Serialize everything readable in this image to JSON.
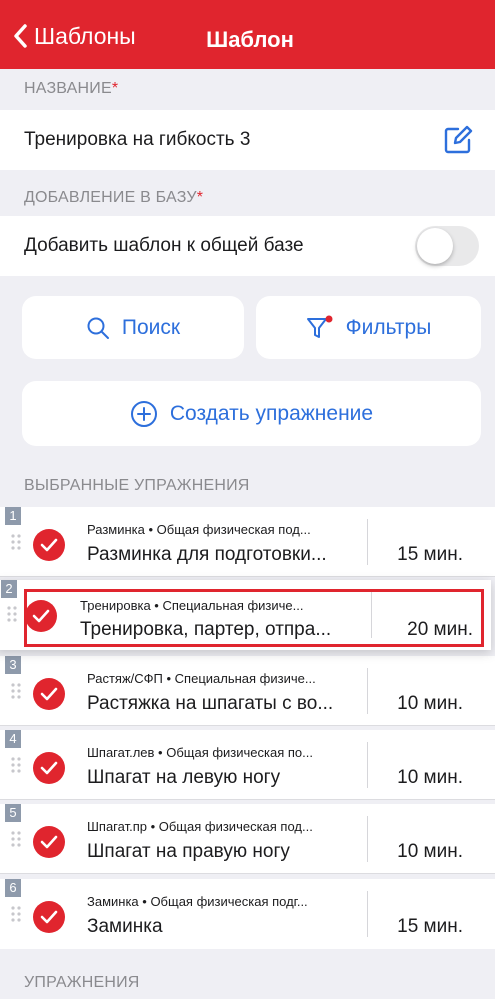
{
  "navbar": {
    "back_label": "Шаблоны",
    "title": "Шаблон"
  },
  "name_section": {
    "header": "НАЗВАНИЕ",
    "required_mark": "*",
    "value": "Тренировка на гибкость 3",
    "edit_icon": "edit-pencil-icon"
  },
  "base_section": {
    "header": "ДОБАВЛЕНИЕ В БАЗУ",
    "required_mark": "*",
    "toggle_label": "Добавить шаблон к общей базе",
    "toggle_on": false
  },
  "actions": {
    "search_label": "Поиск",
    "filters_label": "Фильтры",
    "create_label": "Создать упражнение"
  },
  "selected_section": {
    "header": "ВЫБРАННЫЕ УПРАЖНЕНИЯ",
    "items": [
      {
        "num": "1",
        "category": "Разминка • Общая физическая под...",
        "name": "Разминка для подготовки...",
        "duration": "15 мин."
      },
      {
        "num": "2",
        "category": "Тренировка • Специальная физиче...",
        "name": "Тренировка, партер, отпра...",
        "duration": "20 мин."
      },
      {
        "num": "3",
        "category": "Растяж/СФП • Специальная физиче...",
        "name": "Растяжка на шпагаты с во...",
        "duration": "10 мин."
      },
      {
        "num": "4",
        "category": "Шпагат.лев • Общая физическая по...",
        "name": "Шпагат на левую ногу",
        "duration": "10 мин."
      },
      {
        "num": "5",
        "category": "Шпагат.пр • Общая физическая под...",
        "name": "Шпагат на правую ногу",
        "duration": "10 мин."
      },
      {
        "num": "6",
        "category": "Заминка • Общая физическая подг...",
        "name": "Заминка",
        "duration": "15 мин."
      }
    ]
  },
  "exercises_section": {
    "header": "УПРАЖНЕНИЯ"
  },
  "colors": {
    "accent_red": "#e0252e",
    "link_blue": "#2d6fdc",
    "background": "#efeff4"
  }
}
